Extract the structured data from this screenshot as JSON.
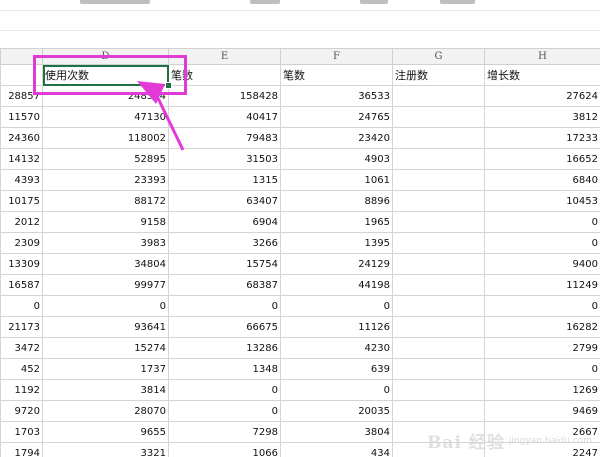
{
  "columns": [
    "D",
    "E",
    "F",
    "G",
    "H"
  ],
  "header_row": [
    "",
    "使用次数",
    "笔数",
    "笔数",
    "注册数",
    "增长数"
  ],
  "rows": [
    [
      "28857",
      "248574",
      "158428",
      "36533",
      "",
      "27624"
    ],
    [
      "11570",
      "47130",
      "40417",
      "24765",
      "",
      "3812"
    ],
    [
      "24360",
      "118002",
      "79483",
      "23420",
      "",
      "17233"
    ],
    [
      "14132",
      "52895",
      "31503",
      "4903",
      "",
      "16652"
    ],
    [
      "4393",
      "23393",
      "1315",
      "1061",
      "",
      "6840"
    ],
    [
      "10175",
      "88172",
      "63407",
      "8896",
      "",
      "10453"
    ],
    [
      "2012",
      "9158",
      "6904",
      "1965",
      "",
      "0"
    ],
    [
      "2309",
      "3983",
      "3266",
      "1395",
      "",
      "0"
    ],
    [
      "13309",
      "34804",
      "15754",
      "24129",
      "",
      "9400"
    ],
    [
      "16587",
      "99977",
      "68387",
      "44198",
      "",
      "11249"
    ],
    [
      "0",
      "0",
      "0",
      "0",
      "",
      "0"
    ],
    [
      "21173",
      "93641",
      "66675",
      "11126",
      "",
      "16282"
    ],
    [
      "3472",
      "15274",
      "13286",
      "4230",
      "",
      "2799"
    ],
    [
      "452",
      "1737",
      "1348",
      "639",
      "",
      "0"
    ],
    [
      "1192",
      "3814",
      "0",
      "0",
      "",
      "1269"
    ],
    [
      "9720",
      "28070",
      "0",
      "20035",
      "",
      "9469"
    ],
    [
      "1703",
      "9655",
      "7298",
      "3804",
      "",
      "2667"
    ],
    [
      "1794",
      "3321",
      "1066",
      "434",
      "",
      "2247"
    ]
  ],
  "annotation_color": "#e23ad7",
  "selection_color": "#1e7145",
  "watermark": {
    "text": "Bai 经验",
    "sub": "jingyan.baidu.com"
  }
}
